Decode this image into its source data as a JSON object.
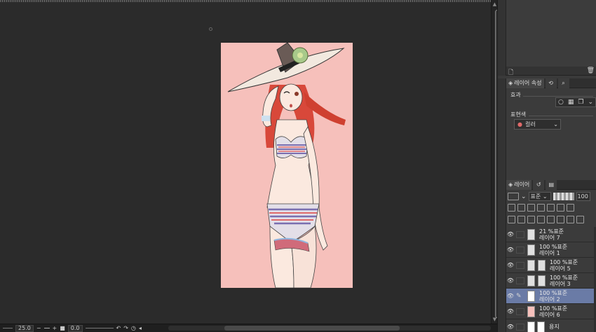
{
  "status_bar": {
    "zoom": "25.0",
    "minus": "−",
    "plus": "+",
    "angle": "0.0"
  },
  "property_panel": {
    "tab_label": "레이어 속성",
    "effect_label": "효과",
    "expression_label": "표현색",
    "expression_value": "컬러"
  },
  "layer_panel": {
    "tab_label": "레이어",
    "blend_mode": "표준",
    "opacity": "100",
    "layers": [
      {
        "line1": "21 %표준",
        "name": "레이어 7"
      },
      {
        "line1": "100 %표준",
        "name": "레이어 1"
      },
      {
        "line1": "100 %표준",
        "name": "레이어 5"
      },
      {
        "line1": "100 %표준",
        "name": "레이어 3"
      },
      {
        "line1": "100 %표준",
        "name": "레이어 2"
      },
      {
        "line1": "100 %표준",
        "name": "레이어 6"
      },
      {
        "line1": "",
        "name": "용지"
      }
    ]
  },
  "colors": {
    "canvas_bg": "#2b2b2b",
    "artwork_bg": "#f6c0bb",
    "panel_bg": "#3a3a3a",
    "selected_layer": "#6a7ba6"
  }
}
